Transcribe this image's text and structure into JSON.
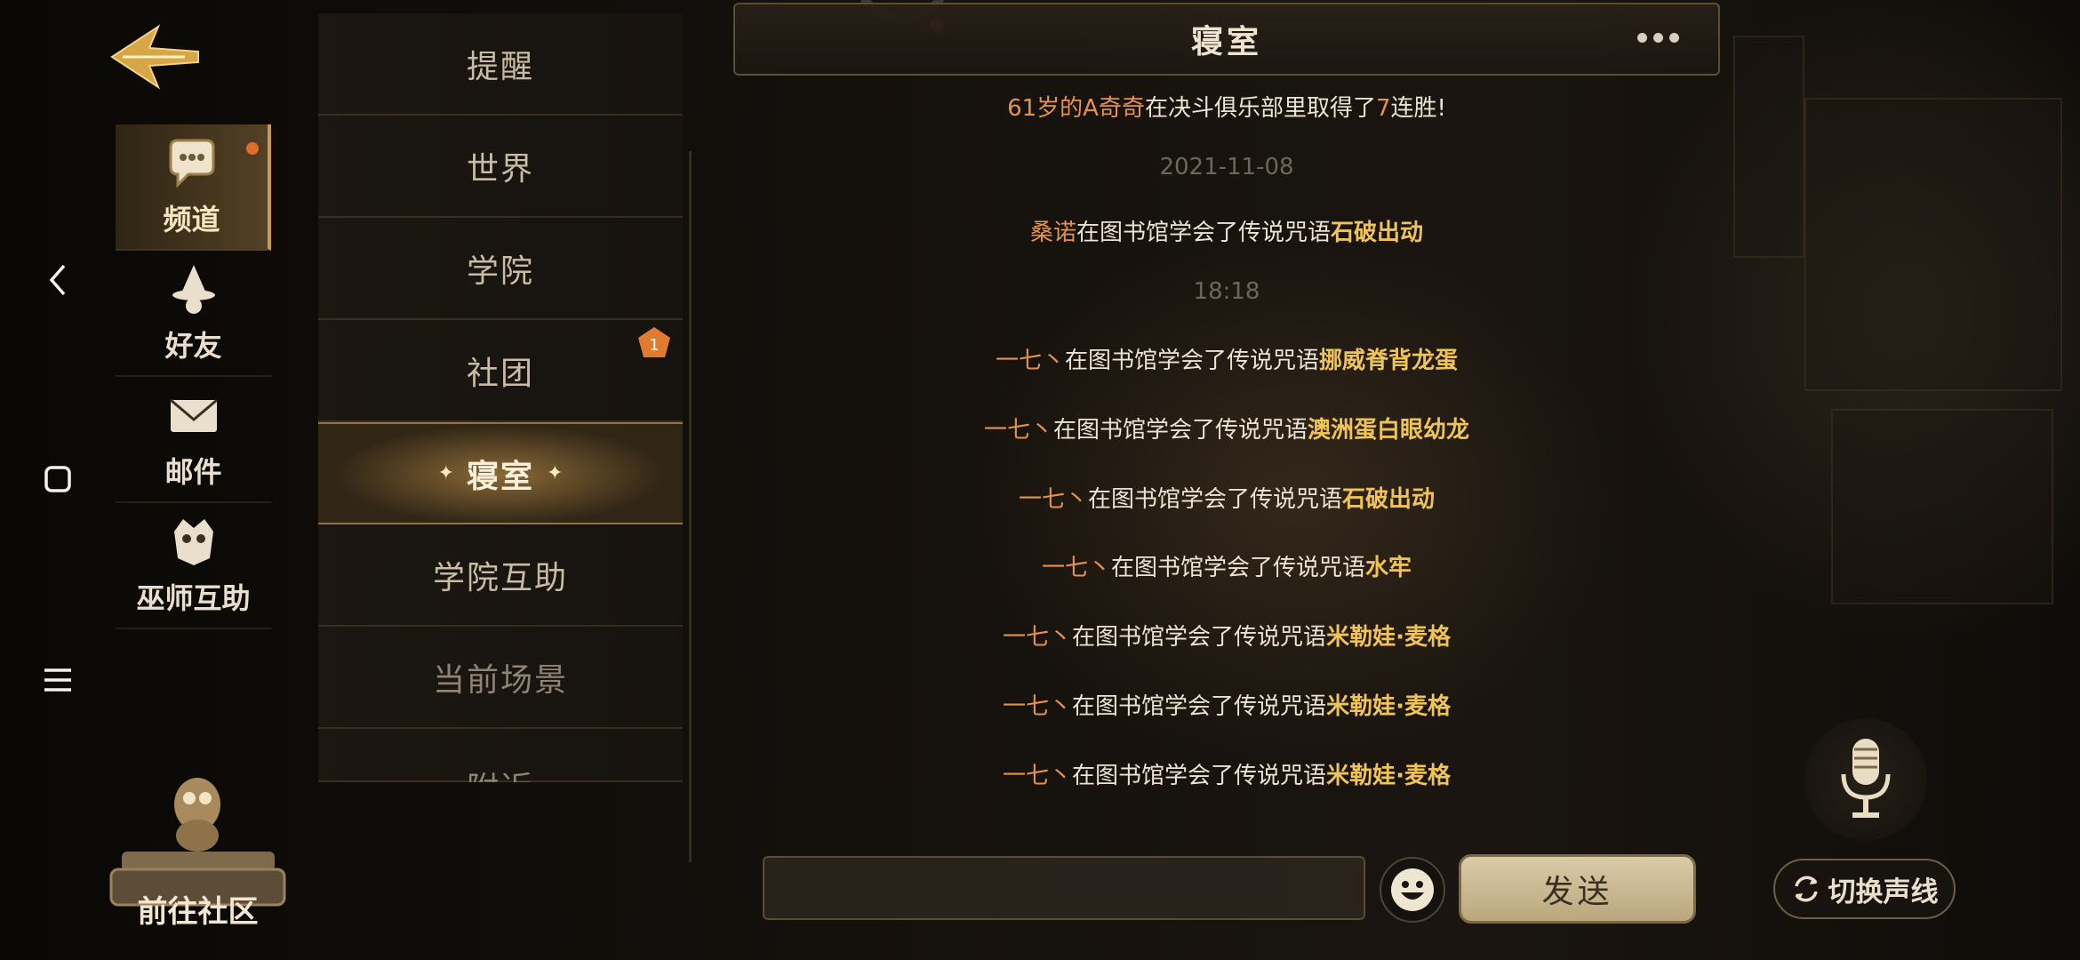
{
  "left_nav": {
    "categories": [
      {
        "label": "频道",
        "icon": "chat-bubble-icon",
        "active": true,
        "has_dot": true
      },
      {
        "label": "好友",
        "icon": "wizard-hat-icon",
        "active": false
      },
      {
        "label": "邮件",
        "icon": "envelope-icon",
        "active": false
      },
      {
        "label": "巫师互助",
        "icon": "owl-emblem-icon",
        "active": false
      }
    ],
    "community_label": "前往社区"
  },
  "channels": {
    "items": [
      {
        "label": "提醒"
      },
      {
        "label": "世界"
      },
      {
        "label": "学院"
      },
      {
        "label": "社团",
        "badge": "1"
      },
      {
        "label": "寝室",
        "active": true
      },
      {
        "label": "学院互助"
      },
      {
        "label": "当前场景"
      },
      {
        "label": "附近"
      }
    ]
  },
  "chat": {
    "title": "寝室",
    "top_message": {
      "name": "61岁的A奇奇",
      "pre": "在决斗俱乐部里取得了",
      "num": "7",
      "post": "连胜!"
    },
    "date_stamp": "2021-11-08",
    "msg_sangnuo": {
      "name": "桑诺",
      "text": "在图书馆学会了传说咒语",
      "spell": "石破出动"
    },
    "time_stamp": "18:18",
    "messages": [
      {
        "name": "一七丶",
        "text": "在图书馆学会了传说咒语",
        "spell": "挪威脊背龙蛋"
      },
      {
        "name": "一七丶",
        "text": "在图书馆学会了传说咒语",
        "spell": "澳洲蛋白眼幼龙"
      },
      {
        "name": "一七丶",
        "text": "在图书馆学会了传说咒语",
        "spell": "石破出动"
      },
      {
        "name": "一七丶",
        "text": "在图书馆学会了传说咒语",
        "spell": "水牢"
      },
      {
        "name": "一七丶",
        "text": "在图书馆学会了传说咒语",
        "spell": "米勒娃·麦格"
      },
      {
        "name": "一七丶",
        "text": "在图书馆学会了传说咒语",
        "spell": "米勒娃·麦格"
      },
      {
        "name": "一七丶",
        "text": "在图书馆学会了传说咒语",
        "spell": "米勒娃·麦格"
      }
    ]
  },
  "input": {
    "value": "",
    "placeholder": ""
  },
  "send_label": "发送",
  "switch_label": "切换声线",
  "colors": {
    "name": "#e4944a",
    "spell": "#efc457",
    "accent": "#c59a57",
    "record": "#e5343f"
  }
}
